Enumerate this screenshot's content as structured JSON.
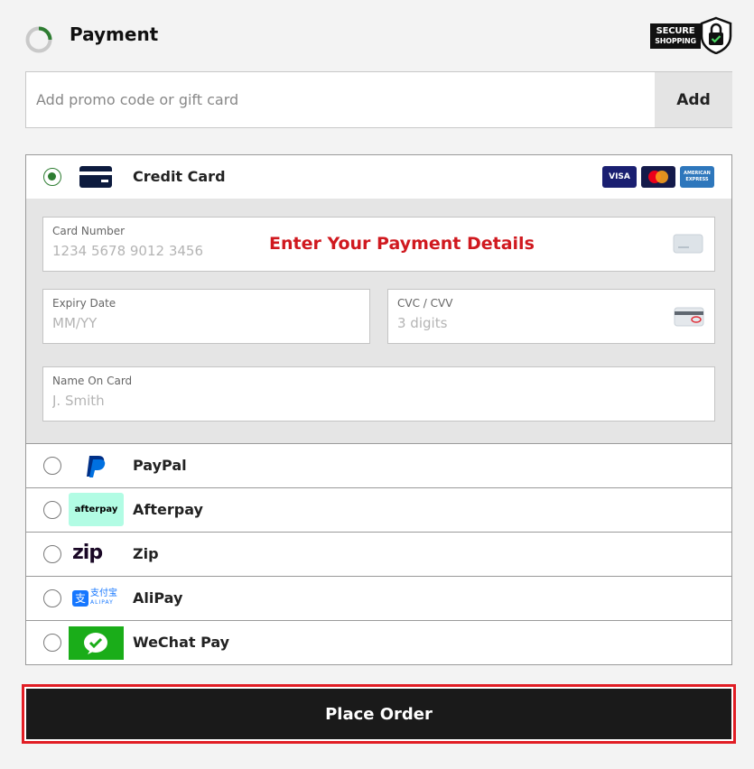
{
  "header": {
    "title": "Payment",
    "secure_badge": [
      "SECURE",
      "SHOPPING"
    ]
  },
  "promo": {
    "placeholder": "Add promo code or gift card",
    "add_label": "Add"
  },
  "payment_methods": [
    {
      "label": "Credit Card",
      "selected": true
    },
    {
      "label": "PayPal",
      "selected": false
    },
    {
      "label": "Afterpay",
      "selected": false
    },
    {
      "label": "Zip",
      "selected": false
    },
    {
      "label": "AliPay",
      "selected": false
    },
    {
      "label": "WeChat Pay",
      "selected": false
    }
  ],
  "card_logos": [
    "VISA",
    "Mastercard",
    "AMERICAN EXPRESS"
  ],
  "card_form": {
    "annotation": "Enter Your Payment Details",
    "card_number": {
      "label": "Card Number",
      "placeholder": "1234 5678 9012 3456"
    },
    "expiry": {
      "label": "Expiry Date",
      "placeholder": "MM/YY"
    },
    "cvc": {
      "label": "CVC / CVV",
      "placeholder": "3 digits"
    },
    "name": {
      "label": "Name On Card",
      "placeholder": "J. Smith"
    }
  },
  "icon_labels": {
    "afterpay": "afterpay",
    "zip": "zip",
    "alipay": "支付宝",
    "alipay_sub": "ALIPAY"
  },
  "colors": {
    "accent_green": "#2e7d32",
    "annotation_red": "#d0191f",
    "place_order_bg": "#1a1a1a",
    "afterpay_mint": "#b2fce4",
    "wechat_green": "#1aad19",
    "paypal_blue": "#003087"
  },
  "place_order_label": "Place Order"
}
